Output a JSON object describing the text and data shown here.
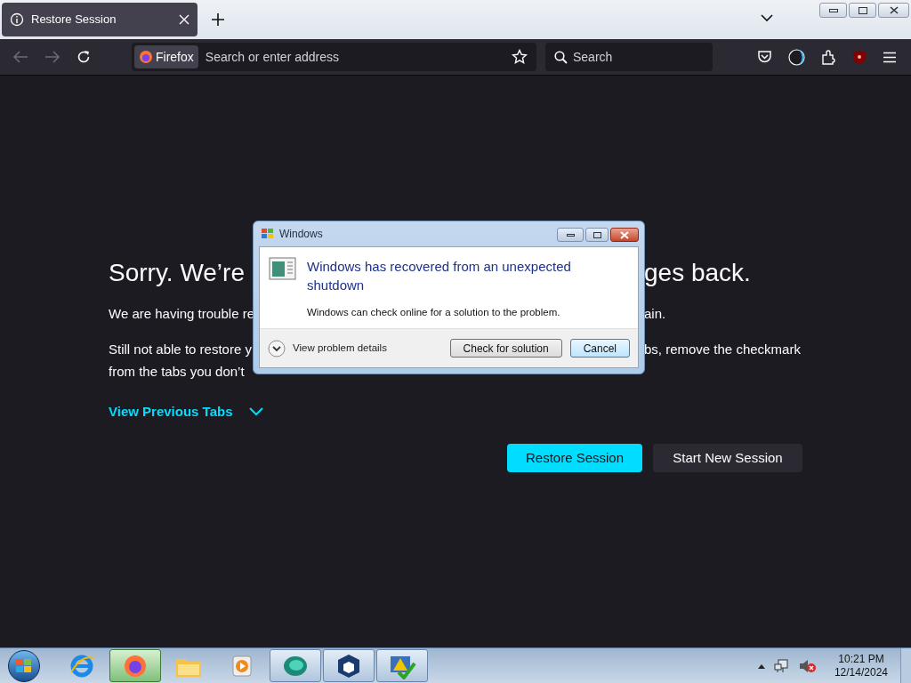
{
  "tab": {
    "title": "Restore Session",
    "selected": true
  },
  "toolbar": {
    "identity": "Firefox",
    "address_placeholder": "Search or enter address",
    "search_placeholder": "Search"
  },
  "page": {
    "heading_left": "Sorry. We’re",
    "heading_right": "ges back.",
    "line_1_left": "We are having trouble re",
    "line_1_right": "ain.",
    "line_2_left": "Still not able to restore y",
    "line_2_right": "bs, remove the checkmark",
    "line_3_left": "from the tabs you don’t",
    "view_tabs": "View Previous Tabs",
    "primary_button": "Restore Session",
    "secondary_button": "Start New Session"
  },
  "dialog": {
    "title": "Windows",
    "heading": "Windows has recovered from an unexpected shutdown",
    "message": "Windows can check online for a solution to the problem.",
    "details": "View problem details",
    "buttons": [
      {
        "label": "Check for solution",
        "focused": false
      },
      {
        "label": "Cancel",
        "focused": true
      }
    ]
  },
  "taskbar": {
    "items": [
      {
        "kind": "ie",
        "running": false,
        "selected": false
      },
      {
        "kind": "firefox",
        "running": true,
        "selected": true
      },
      {
        "kind": "folder",
        "running": false,
        "selected": false
      },
      {
        "kind": "media",
        "running": false,
        "selected": false
      },
      {
        "kind": "chat",
        "running": true,
        "selected": false
      },
      {
        "kind": "cube",
        "running": true,
        "selected": false
      },
      {
        "kind": "warning",
        "running": true,
        "selected": false
      }
    ],
    "time": "10:21 PM",
    "date": "12/14/2024"
  }
}
